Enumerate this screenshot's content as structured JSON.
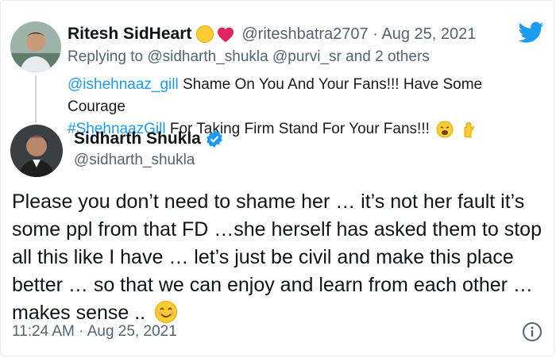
{
  "reply": {
    "name": "Ritesh SidHeart",
    "name_emojis": [
      "hug-emoji",
      "heart-emoji"
    ],
    "handle": "@riteshbatra2707",
    "separator": "·",
    "date": "Aug 25, 2021",
    "replying_prefix": "Replying to",
    "replying_users": "@sidharth_shukla @purvi_sr",
    "replying_suffix": "and 2 others",
    "mention": "@ishehnaaz_gill",
    "text_line1": " Shame On You And Your Fans!!! Have Some Courage",
    "hashtag": "#ShehnaazGill",
    "text_line2": " For Taking Firm Stand For Your Fans!!!",
    "end_emojis": [
      "weary-face-emoji",
      "raised-hand-emoji"
    ]
  },
  "main": {
    "name": "Sidharth Shukla",
    "verified": true,
    "handle": "@sidharth_shukla",
    "text": "Please you don’t need to shame her … it’s not her fault it’s some ppl from that FD …she herself has asked them to stop all this like I have … let’s just be civil and make this place better … so that we can enjoy and learn from each other … makes sense ..",
    "end_emoji": "smiling-face-emoji",
    "time": "11:24 AM",
    "separator": "·",
    "date": "Aug 25, 2021"
  },
  "colors": {
    "link": "#1d9bf0",
    "muted": "#536471",
    "text": "#0f1419",
    "twitter_blue": "#1d9bf0"
  }
}
